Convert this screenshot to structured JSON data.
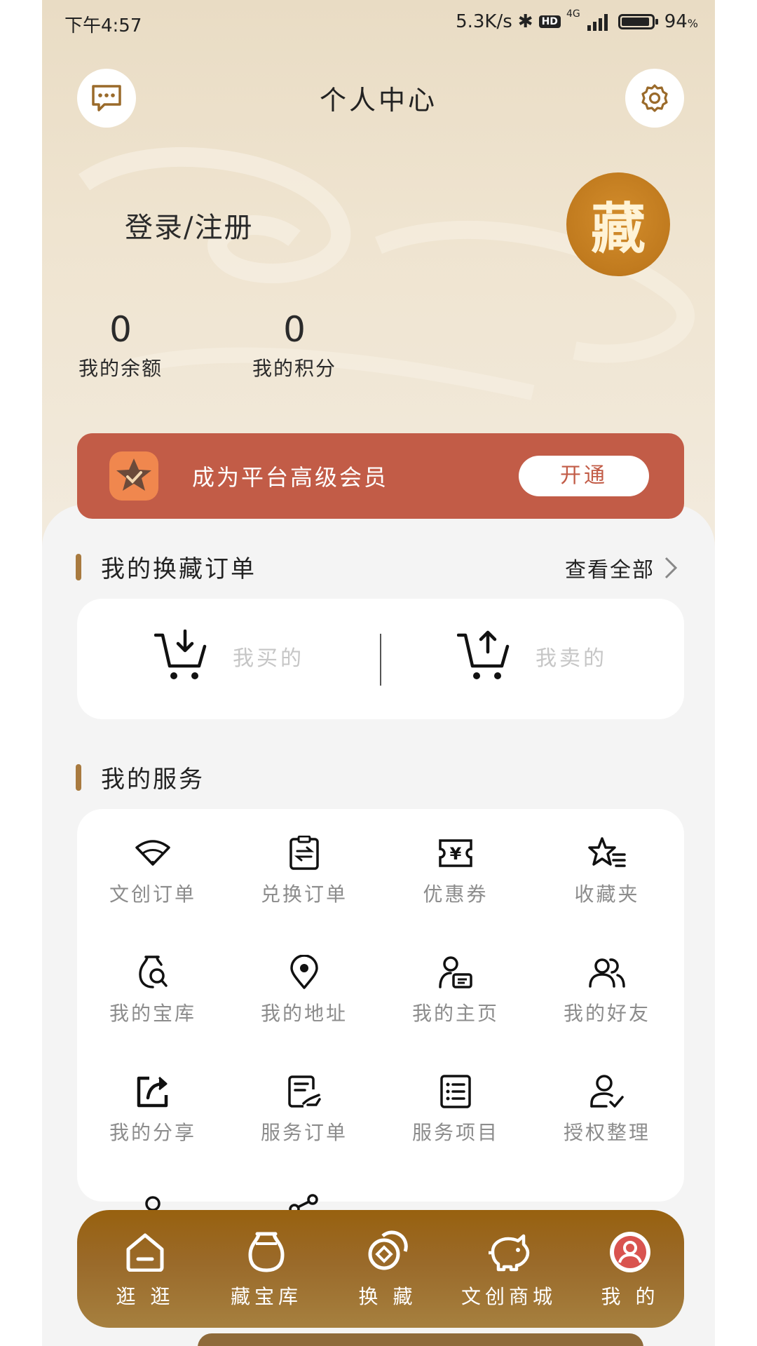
{
  "status": {
    "time": "下午4:57",
    "net_speed": "5.3K/s",
    "hd": "HD",
    "net_type": "4G",
    "battery_percent": "94",
    "battery_unit": "%",
    "battery_level": 0.94
  },
  "header": {
    "title": "个人中心"
  },
  "profile": {
    "login_text": "登录/注册",
    "logo_char": "藏"
  },
  "stats": [
    {
      "value": "0",
      "label": "我的余额"
    },
    {
      "value": "0",
      "label": "我的积分"
    }
  ],
  "vip": {
    "text": "成为平台高级会员",
    "button": "开通"
  },
  "orders": {
    "title": "我的换藏订单",
    "view_all": "查看全部",
    "items": [
      {
        "label": "我买的"
      },
      {
        "label": "我卖的"
      }
    ]
  },
  "services": {
    "title": "我的服务",
    "items": [
      {
        "label": "文创订单",
        "icon": "fan-icon"
      },
      {
        "label": "兑换订单",
        "icon": "exchange-clipboard-icon"
      },
      {
        "label": "优惠券",
        "icon": "coupon-icon"
      },
      {
        "label": "收藏夹",
        "icon": "star-list-icon"
      },
      {
        "label": "我的宝库",
        "icon": "vase-search-icon"
      },
      {
        "label": "我的地址",
        "icon": "location-pin-icon"
      },
      {
        "label": "我的主页",
        "icon": "user-card-icon"
      },
      {
        "label": "我的好友",
        "icon": "friends-icon"
      },
      {
        "label": "我的分享",
        "icon": "share-arrow-icon"
      },
      {
        "label": "服务订单",
        "icon": "service-doc-icon"
      },
      {
        "label": "服务项目",
        "icon": "list-doc-icon"
      },
      {
        "label": "授权整理",
        "icon": "user-check-icon"
      }
    ]
  },
  "tabbar": [
    {
      "label": "逛 逛",
      "icon": "home-icon"
    },
    {
      "label": "藏宝库",
      "icon": "vase-icon"
    },
    {
      "label": "换 藏",
      "icon": "exchange-icon"
    },
    {
      "label": "文创商城",
      "icon": "piggy-icon"
    },
    {
      "label": "我 的",
      "icon": "profile-icon"
    }
  ],
  "colors": {
    "accent": "#c25c47",
    "brown": "#a87a3f",
    "tabbar": "#9a6a2a"
  }
}
